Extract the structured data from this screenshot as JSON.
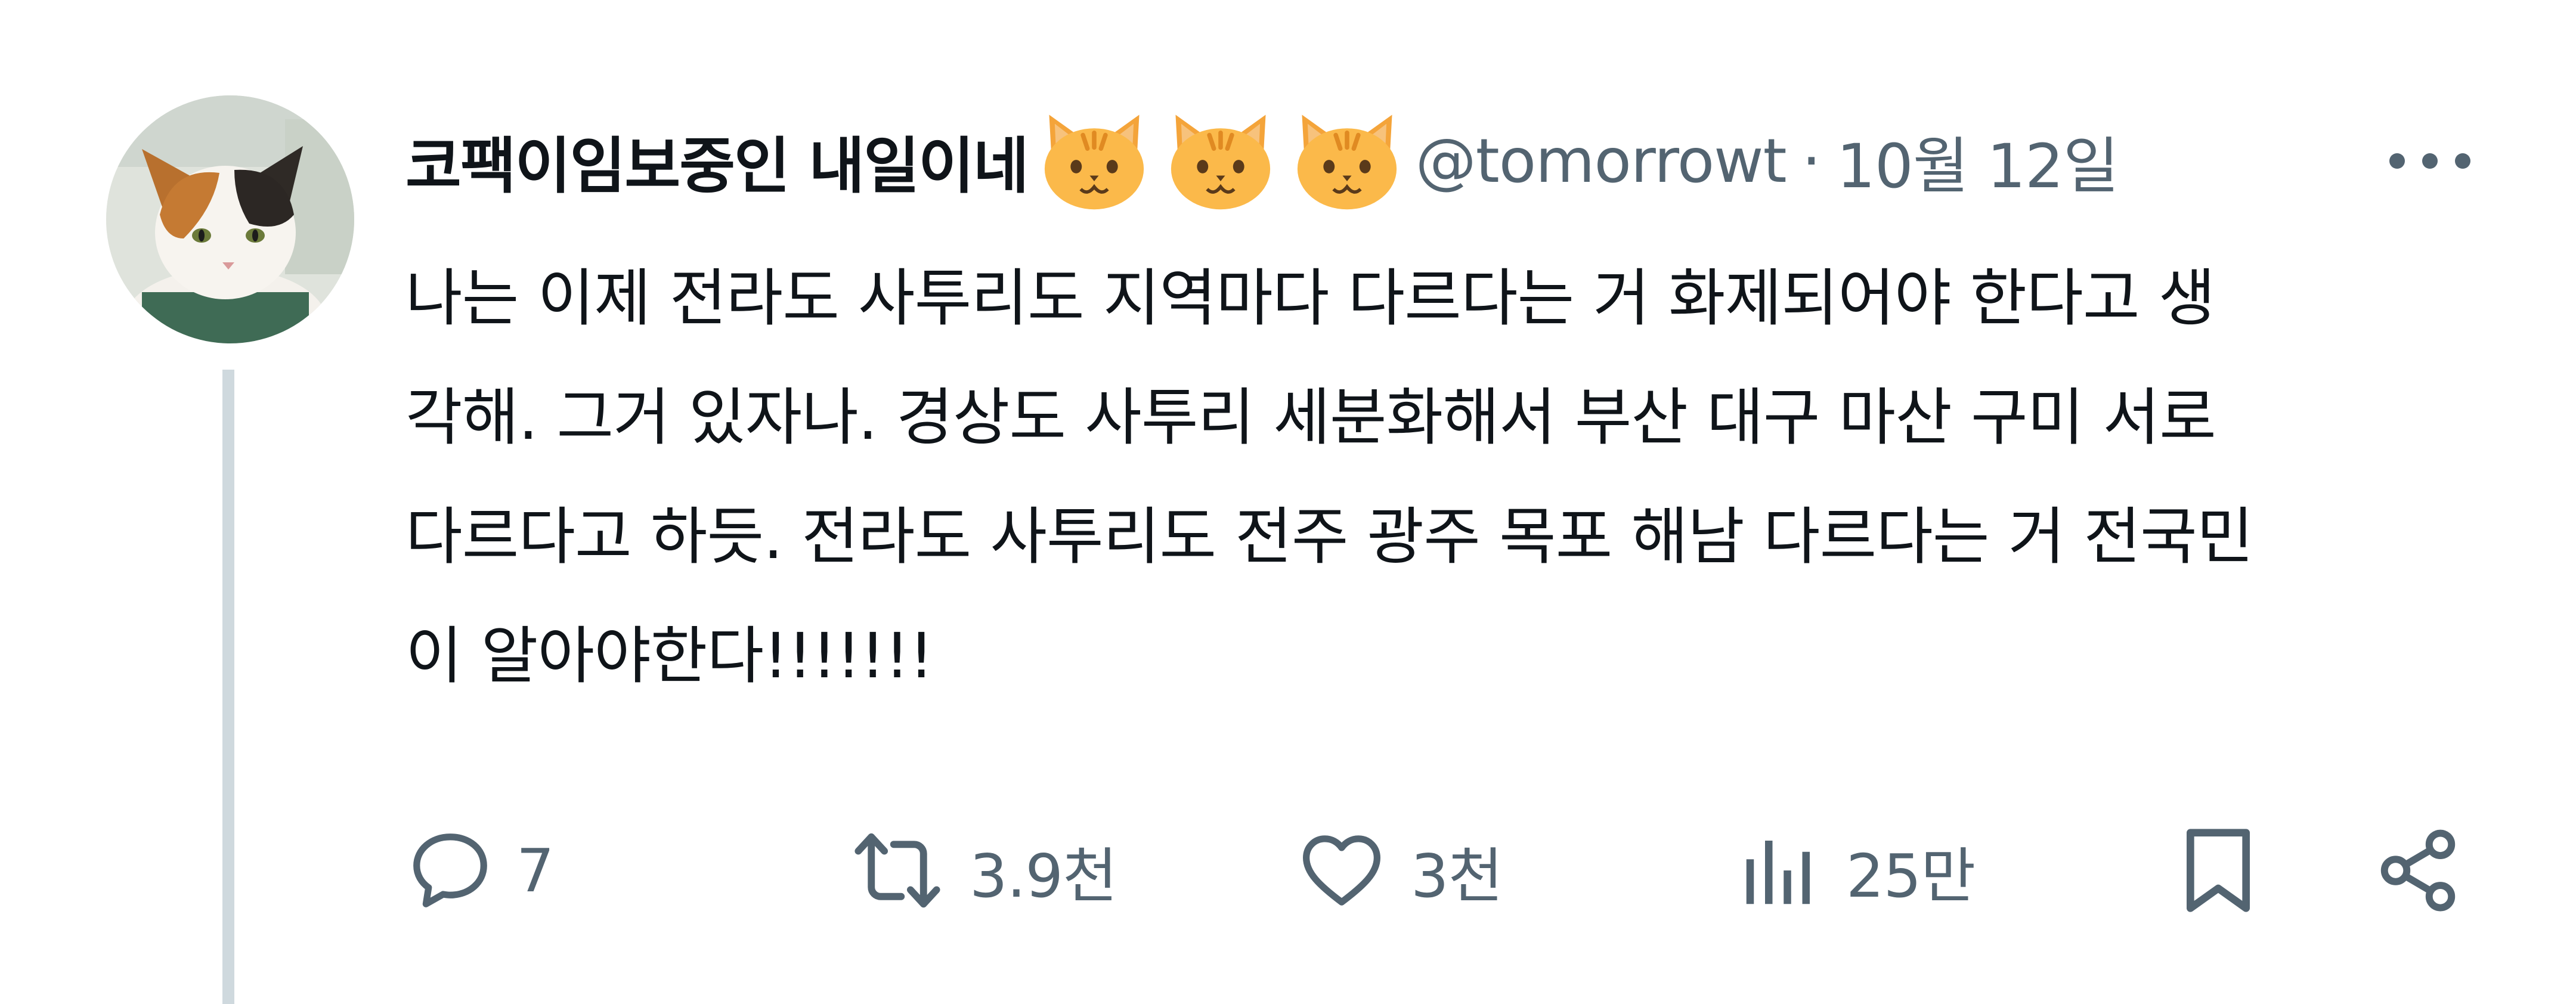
{
  "post": {
    "author": {
      "display_name": "코팩이임보중인 내일이네",
      "handle": "@tomorrowt",
      "name_emojis": [
        "cat-face-icon",
        "cat-face-icon",
        "cat-face-icon"
      ]
    },
    "separator": "·",
    "date": "10월 12일",
    "text_lines": [
      "나는 이제 전라도 사투리도 지역마다 다르다는 거 화제되어야 한다고 생",
      "각해. 그거 있자나. 경상도 사투리 세분화해서 부산 대구 마산 구미  서로",
      "다르다고 하듯. 전라도 사투리도 전주 광주 목포 해남 다르다는 거 전국민",
      "이 알아야한다!!!!!!!"
    ],
    "actions": {
      "replies": "7",
      "reposts": "3.9천",
      "likes": "3천",
      "views": "25만"
    }
  },
  "colors": {
    "text_primary": "#0f1419",
    "text_secondary": "#536471",
    "thread_line": "#cfd9de"
  }
}
